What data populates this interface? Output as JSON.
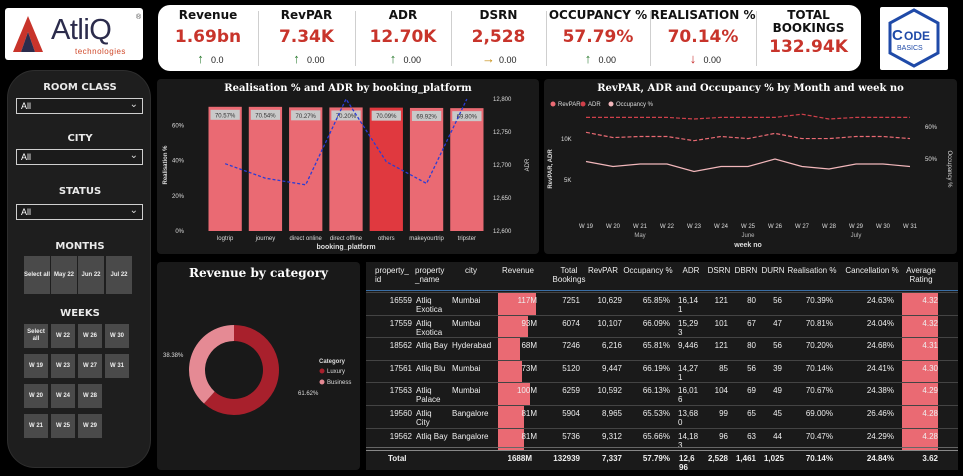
{
  "logo": {
    "brand": "AtliQ",
    "subtitle": "technologies"
  },
  "partner_logo": {
    "line1": "ODE",
    "line2": "BASICS"
  },
  "kpis": [
    {
      "title": "Revenue",
      "value": "1.69bn",
      "trend": "up",
      "delta": "0.0"
    },
    {
      "title": "RevPAR",
      "value": "7.34K",
      "trend": "up",
      "delta": "0.00"
    },
    {
      "title": "ADR",
      "value": "12.70K",
      "trend": "up",
      "delta": "0.00"
    },
    {
      "title": "DSRN",
      "value": "2,528",
      "trend": "flat",
      "delta": "0.00"
    },
    {
      "title": "OCCUPANCY %",
      "value": "57.79%",
      "trend": "up",
      "delta": "0.00"
    },
    {
      "title": "REALISATION %",
      "value": "70.14%",
      "trend": "down",
      "delta": "0.00"
    },
    {
      "title": "TOTAL BOOKINGS",
      "value": "132.94K",
      "trend": "",
      "delta": ""
    }
  ],
  "colors": {
    "up": "#2e7d32",
    "down": "#c62828",
    "flat": "#c48a0b",
    "accent": "#c8342b",
    "bar": "#ea6a73",
    "bar_dark": "#e0393f"
  },
  "filters": {
    "room_class": {
      "label": "ROOM CLASS",
      "value": "All"
    },
    "city": {
      "label": "CITY",
      "value": "All"
    },
    "status": {
      "label": "STATUS",
      "value": "All"
    },
    "months": {
      "label": "MONTHS",
      "items": [
        "Select all",
        "May 22",
        "Jun 22",
        "Jul 22"
      ]
    },
    "weeks": {
      "label": "WEEKS",
      "items": [
        "Select all",
        "W 22",
        "W 26",
        "W 30",
        "W 19",
        "W 23",
        "W 27",
        "W 31",
        "W 20",
        "W 24",
        "W 28",
        "W 21",
        "W 25",
        "W 29"
      ]
    }
  },
  "chart1": {
    "title": "Realisation % and ADR by booking_platform"
  },
  "chart2": {
    "title": "RevPAR, ADR and Occupancy % by Month and week no"
  },
  "chart3": {
    "title": "Revenue by category"
  },
  "chart_data": [
    {
      "type": "bar",
      "title": "Realisation % and ADR by booking_platform",
      "xlabel": "booking_platform",
      "ylabel": "Realisation %",
      "y2label": "ADR",
      "categories": [
        "logtrip",
        "journey",
        "direct online",
        "direct offline",
        "others",
        "makeyourtrip",
        "tripster"
      ],
      "series": [
        {
          "name": "Realisation %",
          "axis": "left",
          "values": [
            70.57,
            70.54,
            70.27,
            70.2,
            70.09,
            69.92,
            69.8
          ],
          "labels": [
            "70.57%",
            "70.54%",
            "70.27%",
            "70.20%",
            "70.09%",
            "69.92%",
            "69.80%"
          ]
        },
        {
          "name": "ADR",
          "axis": "right",
          "kind": "line",
          "values": [
            12702,
            12680,
            12670,
            12800,
            12705,
            12672,
            12800
          ]
        }
      ],
      "ylim": [
        0,
        75
      ],
      "yticks": [
        "0%",
        "20%",
        "40%",
        "60%"
      ],
      "y2lim": [
        12600,
        12800
      ],
      "y2ticks": [
        "12,600",
        "12,650",
        "12,700",
        "12,750",
        "12,800"
      ],
      "highlight_index": 4
    },
    {
      "type": "line",
      "title": "RevPAR, ADR and Occupancy % by Month and week no",
      "xlabel": "week no",
      "ylabel": "RevPAR, ADR",
      "y2label": "Occupancy %",
      "categories": [
        "W 19",
        "W 20",
        "W 21",
        "W 22",
        "W 23",
        "W 24",
        "W 25",
        "W 26",
        "W 27",
        "W 28",
        "W 29",
        "W 30",
        "W 31"
      ],
      "month_labels": [
        {
          "label": "May",
          "at": 2
        },
        {
          "label": "June",
          "at": 6
        },
        {
          "label": "July",
          "at": 10
        }
      ],
      "series": [
        {
          "name": "RevPAR",
          "axis": "left",
          "values": [
            7600,
            7350,
            7400,
            7400,
            7200,
            7400,
            7300,
            7550,
            7300,
            7300,
            7400,
            7400,
            7300
          ]
        },
        {
          "name": "ADR",
          "axis": "left",
          "values": [
            12700,
            12700,
            12700,
            12700,
            12650,
            12700,
            12700,
            12700,
            12800,
            12650,
            12700,
            12700,
            12700
          ]
        },
        {
          "name": "Occupancy %",
          "axis": "right",
          "values": [
            59,
            57,
            58,
            58,
            55,
            57,
            57,
            60,
            57,
            56,
            58,
            58,
            57
          ]
        }
      ],
      "yticks": [
        "5K",
        "10K"
      ],
      "y2ticks": [
        "50%",
        "60%"
      ],
      "legend": "top-left"
    },
    {
      "type": "pie",
      "title": "Revenue by category",
      "legend_title": "Category",
      "slices": [
        {
          "label": "Luxury",
          "value": 61.62,
          "text": "61.62%"
        },
        {
          "label": "Business",
          "value": 38.38,
          "text": "38.38%"
        }
      ],
      "legend": "right"
    }
  ],
  "table": {
    "columns": [
      "property_id",
      "property_name",
      "city",
      "Revenue",
      "Total Bookings",
      "RevPAR",
      "Occupancy %",
      "ADR",
      "DSRN",
      "DBRN",
      "DURN",
      "Realisation %",
      "Cancellation %",
      "Average Rating"
    ],
    "header_labels": {
      "property_id": "property_\nid",
      "property_name": "property\n_name",
      "city": "city",
      "revenue": "Revenue",
      "bookings": "Total\nBookings",
      "revpar": "RevPAR",
      "occ": "Occupancy %",
      "adr": "ADR",
      "dsrn": "DSRN",
      "dbrn": "DBRN",
      "durn": "DURN",
      "real": "Realisation %",
      "canc": "Cancellation %",
      "rating": "Average\nRating"
    },
    "rows": [
      {
        "id": "16559",
        "name": "Atliq\nExotica",
        "city": "Mumbai",
        "revenue": "117M",
        "revenue_val": 117,
        "bookings": "7251",
        "revpar": "10,629",
        "occ": "65.85%",
        "adr": "16,14\n1",
        "dsrn": "121",
        "dbrn": "80",
        "durn": "56",
        "real": "70.39%",
        "canc": "24.63%",
        "rating": "4.32",
        "rating_val": 4.32
      },
      {
        "id": "17559",
        "name": "Atliq\nExotica",
        "city": "Mumbai",
        "revenue": "93M",
        "revenue_val": 93,
        "bookings": "6074",
        "revpar": "10,107",
        "occ": "66.09%",
        "adr": "15,29\n3",
        "dsrn": "101",
        "dbrn": "67",
        "durn": "47",
        "real": "70.81%",
        "canc": "24.04%",
        "rating": "4.32",
        "rating_val": 4.32
      },
      {
        "id": "18562",
        "name": "Atliq Bay",
        "city": "Hyderabad",
        "revenue": "68M",
        "revenue_val": 68,
        "bookings": "7246",
        "revpar": "6,216",
        "occ": "65.81%",
        "adr": "9,446",
        "dsrn": "121",
        "dbrn": "80",
        "durn": "56",
        "real": "70.20%",
        "canc": "24.68%",
        "rating": "4.31",
        "rating_val": 4.31
      },
      {
        "id": "17561",
        "name": "Atliq Blu",
        "city": "Mumbai",
        "revenue": "73M",
        "revenue_val": 73,
        "bookings": "5120",
        "revpar": "9,447",
        "occ": "66.19%",
        "adr": "14,27\n1",
        "dsrn": "85",
        "dbrn": "56",
        "durn": "39",
        "real": "70.14%",
        "canc": "24.41%",
        "rating": "4.30",
        "rating_val": 4.3
      },
      {
        "id": "17563",
        "name": "Atliq\nPalace",
        "city": "Mumbai",
        "revenue": "100M",
        "revenue_val": 100,
        "bookings": "6259",
        "revpar": "10,592",
        "occ": "66.13%",
        "adr": "16,01\n6",
        "dsrn": "104",
        "dbrn": "69",
        "durn": "49",
        "real": "70.67%",
        "canc": "24.38%",
        "rating": "4.29",
        "rating_val": 4.29
      },
      {
        "id": "19560",
        "name": "Atliq\nCity",
        "city": "Bangalore",
        "revenue": "81M",
        "revenue_val": 81,
        "bookings": "5904",
        "revpar": "8,965",
        "occ": "65.53%",
        "adr": "13,68\n0",
        "dsrn": "99",
        "dbrn": "65",
        "durn": "45",
        "real": "69.00%",
        "canc": "26.46%",
        "rating": "4.28",
        "rating_val": 4.28
      },
      {
        "id": "19562",
        "name": "Atliq Bay",
        "city": "Bangalore",
        "revenue": "81M",
        "revenue_val": 81,
        "bookings": "5736",
        "revpar": "9,312",
        "occ": "65.66%",
        "adr": "14,18\n3",
        "dsrn": "96",
        "dbrn": "63",
        "durn": "44",
        "real": "70.47%",
        "canc": "24.29%",
        "rating": "4.28",
        "rating_val": 4.28
      }
    ],
    "total": {
      "label": "Total",
      "revenue": "1688M",
      "bookings": "132939",
      "revpar": "7,337",
      "occ": "57.79%",
      "adr": "12,6\n96",
      "dsrn": "2,528",
      "dbrn": "1,461",
      "durn": "1,025",
      "real": "70.14%",
      "canc": "24.84%",
      "rating": "3.62"
    }
  }
}
